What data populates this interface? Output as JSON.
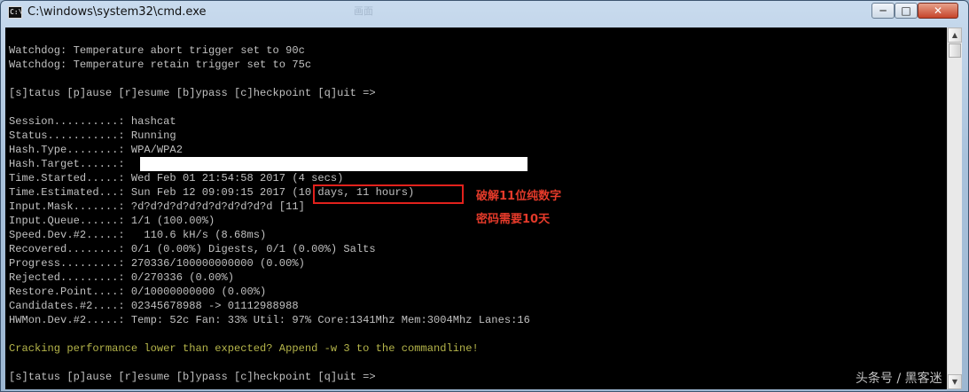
{
  "window": {
    "title": "C:\\windows\\system32\\cmd.exe",
    "icon_label": "C:\\",
    "ghost_tabs": [
      "画面",
      "",
      ""
    ],
    "controls": {
      "minimize": "─",
      "maximize": "□",
      "close": "✕"
    }
  },
  "console_lines": [
    "Watchdog: Temperature abort trigger set to 90c",
    "Watchdog: Temperature retain trigger set to 75c",
    "",
    "[s]tatus [p]ause [r]esume [b]ypass [c]heckpoint [q]uit =>",
    "",
    "Session..........: hashcat",
    "Status...........: Running",
    "Hash.Type........: WPA/WPA2",
    "Hash.Target......: ",
    "Time.Started.....: Wed Feb 01 21:54:58 2017 (4 secs)",
    "Time.Estimated...: Sun Feb 12 09:09:15 2017 (10 days, 11 hours)",
    "Input.Mask.......: ?d?d?d?d?d?d?d?d?d?d?d [11]",
    "Input.Queue......: 1/1 (100.00%)",
    "Speed.Dev.#2.....:   110.6 kH/s (8.68ms)",
    "Recovered........: 0/1 (0.00%) Digests, 0/1 (0.00%) Salts",
    "Progress.........: 270336/100000000000 (0.00%)",
    "Rejected.........: 0/270336 (0.00%)",
    "Restore.Point....: 0/10000000000 (0.00%)",
    "Candidates.#2....: 02345678988 -> 01112988988",
    "HWMon.Dev.#2.....: Temp: 52c Fan: 33% Util: 97% Core:1341Mhz Mem:3004Mhz Lanes:16",
    "",
    "Cracking performance lower than expected? Append -w 3 to the commandline!",
    "",
    "[s]tatus [p]ause [r]esume [b]ypass [c]heckpoint [q]uit =>"
  ],
  "annotation": {
    "line1": "破解11位纯数字",
    "line2": "密码需要10天"
  },
  "watermark": "头条号 / 黑客迷",
  "colors": {
    "console_bg": "#000000",
    "console_text": "#c0c0c0",
    "warning_text": "#b5b54a",
    "annotation": "#e43a2a"
  }
}
